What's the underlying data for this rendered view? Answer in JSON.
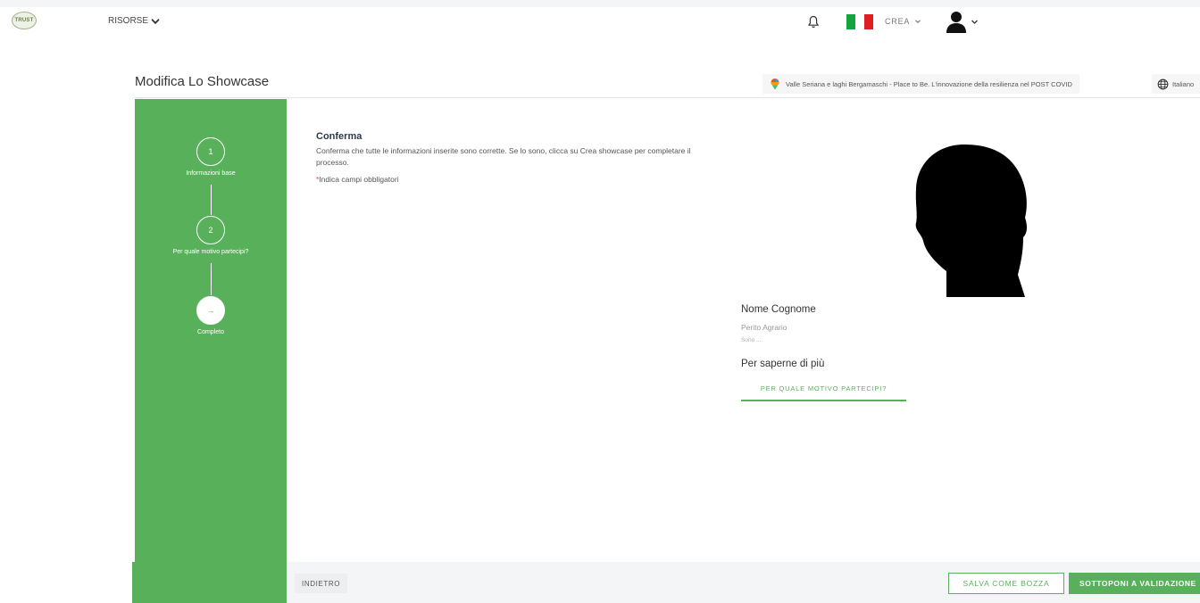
{
  "app": {
    "logo_text": "TRUST"
  },
  "nav": {
    "resources_label": "RISORSE",
    "create_label": "CREA",
    "icons": [
      "bell-icon",
      "italian-flag-icon",
      "chevron-down-icon",
      "user-icon"
    ]
  },
  "header": {
    "title": "Modifica Lo Showcase",
    "context": "Valle Seriana e laghi Bergamaschi - Place to Be. L'innovazione della resilienza nel POST COVID",
    "language": "Italiano"
  },
  "stepper": {
    "steps": [
      {
        "number": "1",
        "label": "Informazioni base",
        "state": "done"
      },
      {
        "number": "2",
        "label": "Per quale motivo partecipi?",
        "state": "done"
      },
      {
        "number": "→",
        "label": "Completo",
        "state": "active"
      }
    ]
  },
  "confirm": {
    "title": "Conferma",
    "description": "Conferma che tutte le informazioni inserite sono corrette. Se lo sono, clicca su Crea showcase per completare il processo.",
    "required_marker": "*",
    "required_note": "Indica campi obbligatori"
  },
  "profile": {
    "name": "Nome Cognome",
    "role": "Perito Agrario",
    "bio": "Sono ....",
    "learn_more_title": "Per saperne di più",
    "tab_label": "PER QUALE MOTIVO PARTECIPI?"
  },
  "footer": {
    "back_label": "INDIETRO",
    "draft_label": "SALVA COME BOZZA",
    "submit_label": "SOTTOPONI A VALIDAZIONE"
  },
  "colors": {
    "accent": "#58b15a",
    "required": "#e0483e",
    "flag_green": "#14a33e",
    "flag_red": "#e11d24"
  }
}
